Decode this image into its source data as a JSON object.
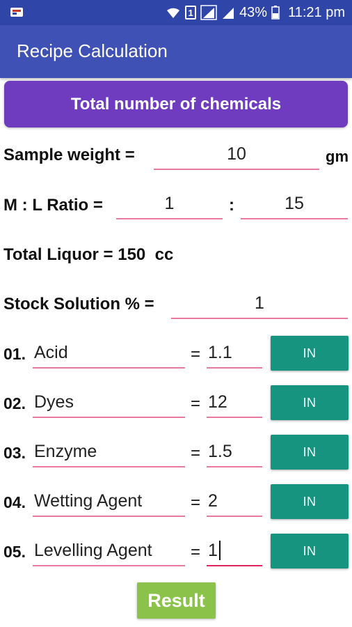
{
  "status_bar": {
    "battery_percent": "43%",
    "time": "11:21 pm",
    "sim_label": "1",
    "icons": [
      "notification-app-icon",
      "wifi-icon",
      "sim-icon",
      "signal-icon",
      "signal-icon",
      "battery-icon"
    ]
  },
  "app_bar": {
    "title": "Recipe Calculation"
  },
  "header": {
    "label": "Total number of chemicals"
  },
  "sample_weight": {
    "label": "Sample weight =",
    "value": "10",
    "unit": "gm"
  },
  "ml_ratio": {
    "label": "M : L Ratio =",
    "m_value": "1",
    "separator": ":",
    "l_value": "15"
  },
  "total_liquor": {
    "label": "Total Liquor = 150  cc"
  },
  "stock_solution": {
    "label": "Stock Solution % =",
    "value": "1"
  },
  "chemicals": [
    {
      "num": "01.",
      "name": "Acid",
      "eq": "=",
      "value": "1.1",
      "button": "IN"
    },
    {
      "num": "02.",
      "name": "Dyes",
      "eq": "=",
      "value": "12",
      "button": "IN"
    },
    {
      "num": "03.",
      "name": "Enzyme",
      "eq": "=",
      "value": "1.5",
      "button": "IN"
    },
    {
      "num": "04.",
      "name": "Wetting Agent",
      "eq": "=",
      "value": "2",
      "button": "IN"
    },
    {
      "num": "05.",
      "name": "Levelling Agent",
      "eq": "=",
      "value": "1",
      "button": "IN"
    }
  ],
  "result_button": {
    "label": "Result"
  },
  "colors": {
    "status_bar": "#2f45a8",
    "app_bar": "#3f51b5",
    "header_button": "#6f3bbf",
    "in_button": "#16947f",
    "result_button": "#8bc34a",
    "field_underline": "#e87aa0"
  }
}
